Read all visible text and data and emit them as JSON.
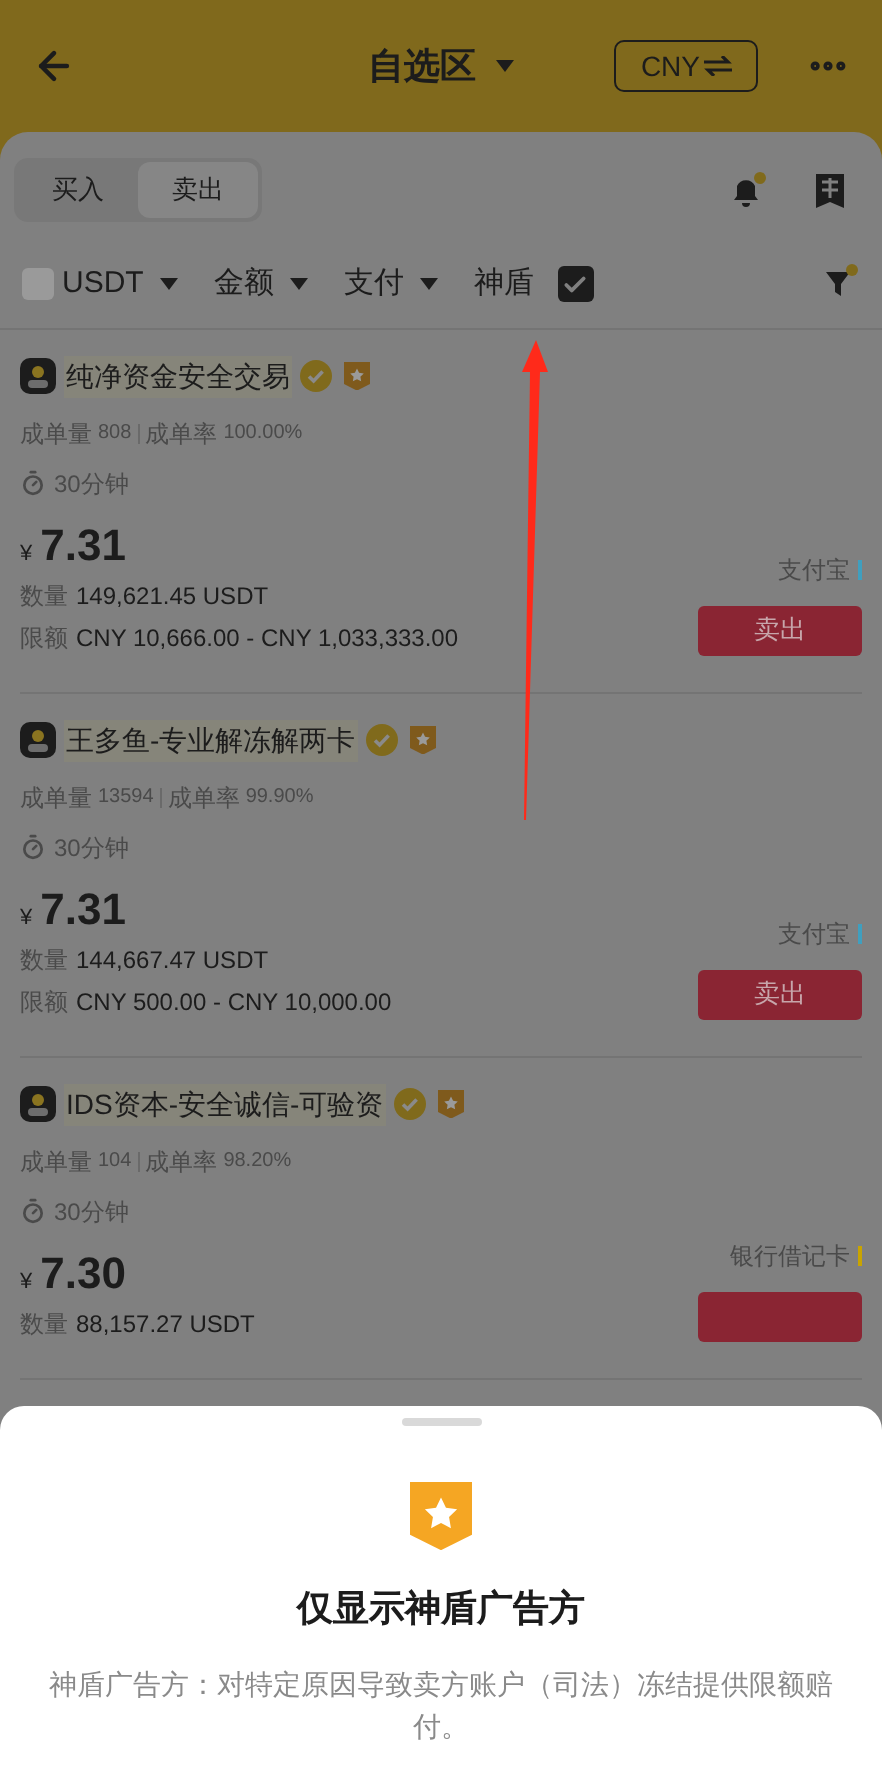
{
  "header": {
    "title": "自选区",
    "currency": "CNY"
  },
  "trade_tabs": [
    {
      "label": "买入",
      "selected": false
    },
    {
      "label": "卖出",
      "selected": true
    }
  ],
  "filters": [
    {
      "kind": "dropdown",
      "label": "USDT"
    },
    {
      "kind": "dropdown",
      "label": "金额"
    },
    {
      "kind": "dropdown",
      "label": "支付"
    },
    {
      "kind": "checkbox",
      "label": "神盾",
      "checked": true
    }
  ],
  "ads": [
    {
      "name": "纯净资金安全交易",
      "orders_label": "成单量",
      "orders": "808",
      "rate_label": "成单率",
      "rate": "100.00%",
      "time": "30分钟",
      "currency": "¥",
      "price": "7.31",
      "qty_label": "数量",
      "qty": "149,621.45 USDT",
      "limit_label": "限额",
      "limit": "CNY 10,666.00 - CNY 1,033,333.00",
      "payment": "支付宝",
      "color": "#3f9fbf",
      "action": "卖出"
    },
    {
      "name": "王多鱼-专业解冻解两卡",
      "orders_label": "成单量",
      "orders": "13594",
      "rate_label": "成单率",
      "rate": "99.90%",
      "time": "30分钟",
      "currency": "¥",
      "price": "7.31",
      "qty_label": "数量",
      "qty": "144,667.47 USDT",
      "limit_label": "限额",
      "limit": "CNY 500.00 - CNY 10,000.00",
      "payment": "支付宝",
      "color": "#3f9fbf",
      "action": "卖出"
    },
    {
      "name": "IDS资本-安全诚信-可验资",
      "orders_label": "成单量",
      "orders": "104",
      "rate_label": "成单率",
      "rate": "98.20%",
      "time": "30分钟",
      "currency": "¥",
      "price": "7.30",
      "qty_label": "数量",
      "qty": "88,157.27 USDT",
      "payment": "银行借记卡",
      "color": "#c9a400"
    }
  ],
  "sheet": {
    "title": "仅显示神盾广告方",
    "description": "神盾广告方：对特定原因导致卖方账户（司法）冻结提供限额赔付。"
  }
}
